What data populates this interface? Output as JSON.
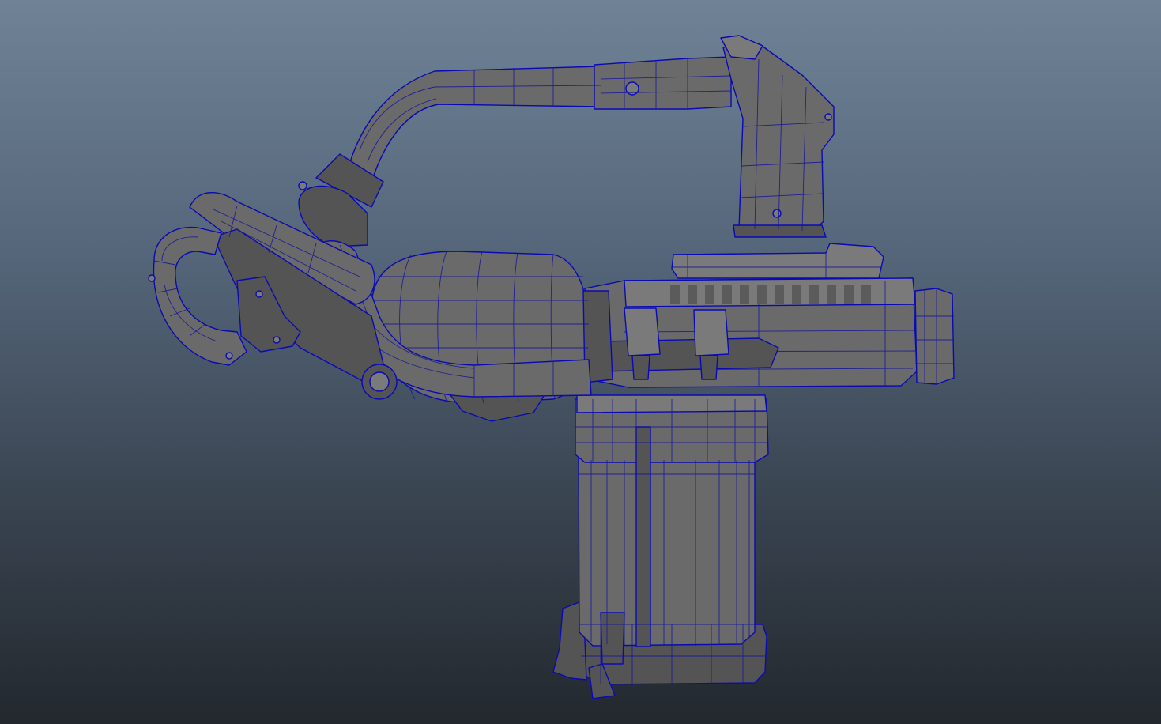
{
  "viewport": {
    "background_top": "#6f8296",
    "background_bottom": "#23282e",
    "mesh_color": "#6a6a6a",
    "wireframe_color": "#0a0ab4",
    "display_mode": "wireframe-on-shaded"
  },
  "model": {
    "parts": [
      "handle-ring",
      "front-grip",
      "curved-hose",
      "carry-handle",
      "fuel-tank",
      "barrel",
      "pilot-light-clamps",
      "muzzle",
      "cylinder-base"
    ]
  }
}
